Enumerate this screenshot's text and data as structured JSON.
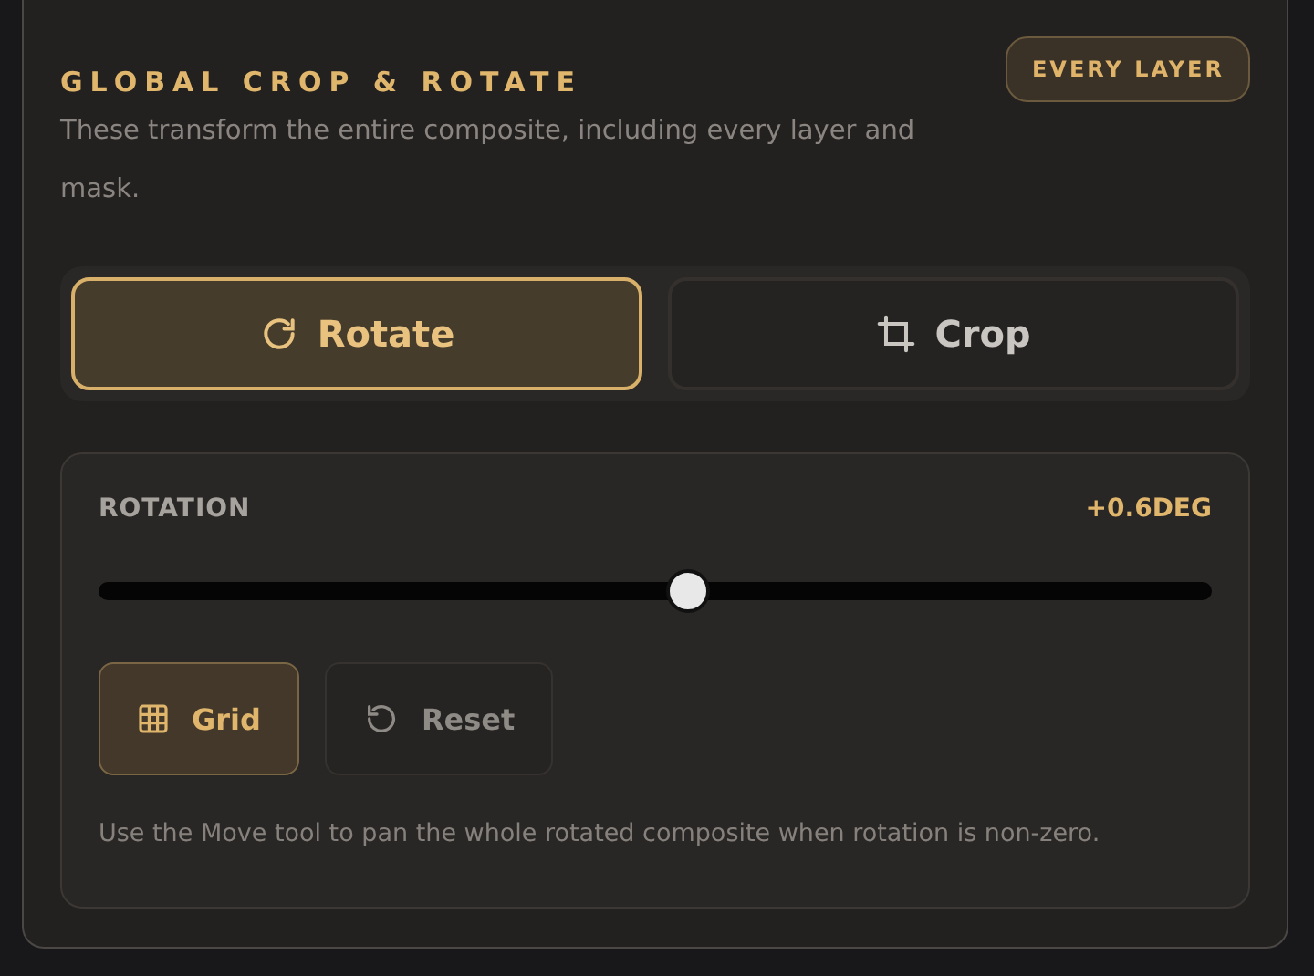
{
  "panel": {
    "title": "GLOBAL CROP & ROTATE",
    "badge": "EVERY LAYER",
    "description": "These transform the entire composite, including every layer and mask."
  },
  "modes": [
    {
      "label": "Rotate",
      "kind": "rotate",
      "selected": true
    },
    {
      "label": "Crop",
      "kind": "crop",
      "selected": false
    }
  ],
  "rotation": {
    "label": "ROTATION",
    "reading": "+0.6DEG",
    "level": 0.53
  },
  "tools": [
    {
      "label": "Grid",
      "kind": "grid",
      "on": true
    },
    {
      "label": "Reset",
      "kind": "reset",
      "on": false
    }
  ],
  "note": "Use the Move tool to pan the whole rotated composite when rotation is non-zero."
}
